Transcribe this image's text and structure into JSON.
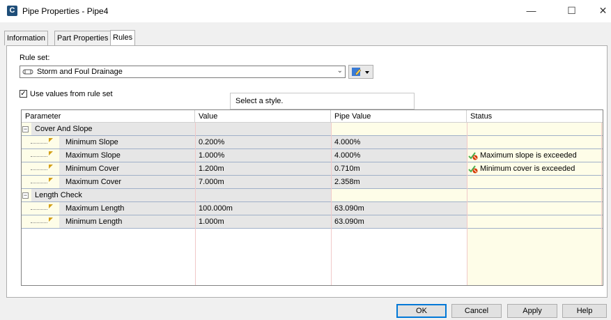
{
  "window": {
    "title": "Pipe Properties - Pipe4",
    "app_icon_letter": "C"
  },
  "tabs": [
    {
      "label": "Information"
    },
    {
      "label": "Part Properties"
    },
    {
      "label": "Rules"
    }
  ],
  "rules": {
    "rule_set_label": "Rule set:",
    "rule_set_value": "Storm and Foul Drainage",
    "use_values_label": "Use values from rule set",
    "use_values_checked": true,
    "tooltip": "Select a style."
  },
  "grid": {
    "columns": [
      "Parameter",
      "Value",
      "Pipe Value",
      "Status"
    ],
    "groups": [
      {
        "name": "Cover And Slope",
        "rows": [
          {
            "parameter": "Minimum Slope",
            "value": "0.200%",
            "pipe_value": "4.000%",
            "status": ""
          },
          {
            "parameter": "Maximum Slope",
            "value": "1.000%",
            "pipe_value": "4.000%",
            "status": "Maximum slope is exceeded"
          },
          {
            "parameter": "Minimum Cover",
            "value": "1.200m",
            "pipe_value": "0.710m",
            "status": "Minimum cover is exceeded"
          },
          {
            "parameter": "Maximum Cover",
            "value": "7.000m",
            "pipe_value": "2.358m",
            "status": ""
          }
        ]
      },
      {
        "name": "Length Check",
        "rows": [
          {
            "parameter": "Maximum Length",
            "value": "100.000m",
            "pipe_value": "63.090m",
            "status": ""
          },
          {
            "parameter": "Minimum Length",
            "value": "1.000m",
            "pipe_value": "63.090m",
            "status": ""
          }
        ]
      }
    ]
  },
  "buttons": {
    "ok": "OK",
    "cancel": "Cancel",
    "apply": "Apply",
    "help": "Help"
  },
  "colors": {
    "accent": "#0078d7",
    "warning": "#d83b01",
    "check": "#4caf50"
  }
}
